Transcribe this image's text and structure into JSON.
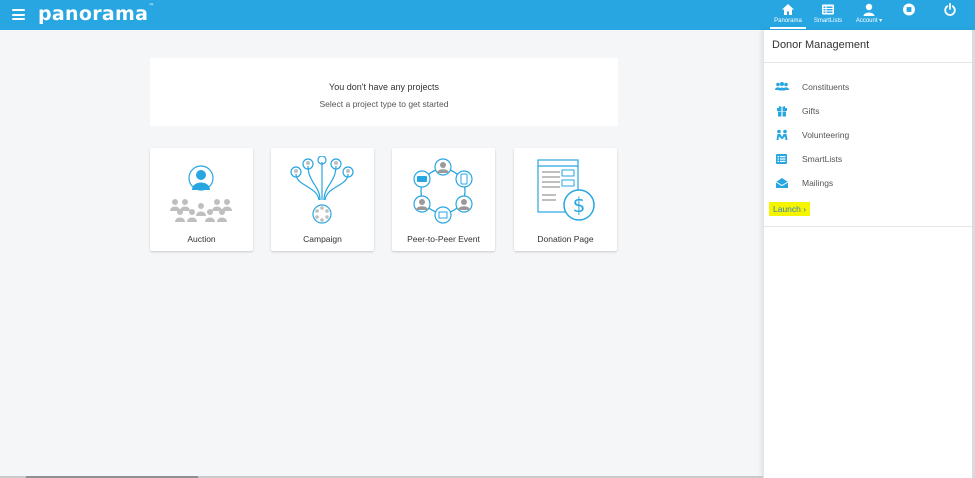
{
  "header": {
    "logo_text": "panorama",
    "logo_tm": "™",
    "nav": [
      {
        "label": "Panorama",
        "icon": "home-icon"
      },
      {
        "label": "SmartLists",
        "icon": "list-icon"
      },
      {
        "label": "Account ▾",
        "icon": "user-icon"
      },
      {
        "label": "",
        "icon": "stop-icon"
      },
      {
        "label": "",
        "icon": "power-icon"
      }
    ]
  },
  "main": {
    "empty_title": "You don't have any projects",
    "empty_subtitle": "Select a project type to get started",
    "cards": [
      {
        "label": "Auction",
        "icon": "auction-icon"
      },
      {
        "label": "Campaign",
        "icon": "campaign-icon"
      },
      {
        "label": "Peer-to-Peer Event",
        "icon": "peer-to-peer-icon"
      },
      {
        "label": "Donation Page",
        "icon": "donation-page-icon"
      }
    ]
  },
  "panel": {
    "title": "Donor Management",
    "items": [
      {
        "label": "Constituents",
        "icon": "users-icon"
      },
      {
        "label": "Gifts",
        "icon": "gift-icon"
      },
      {
        "label": "Volunteering",
        "icon": "volunteer-icon"
      },
      {
        "label": "SmartLists",
        "icon": "list-icon"
      },
      {
        "label": "Mailings",
        "icon": "envelope-icon"
      }
    ],
    "launch_label": "Launch ›"
  },
  "colors": {
    "brand": "#27a6e1",
    "highlight": "#f5f500",
    "link": "#3a7fc1"
  }
}
